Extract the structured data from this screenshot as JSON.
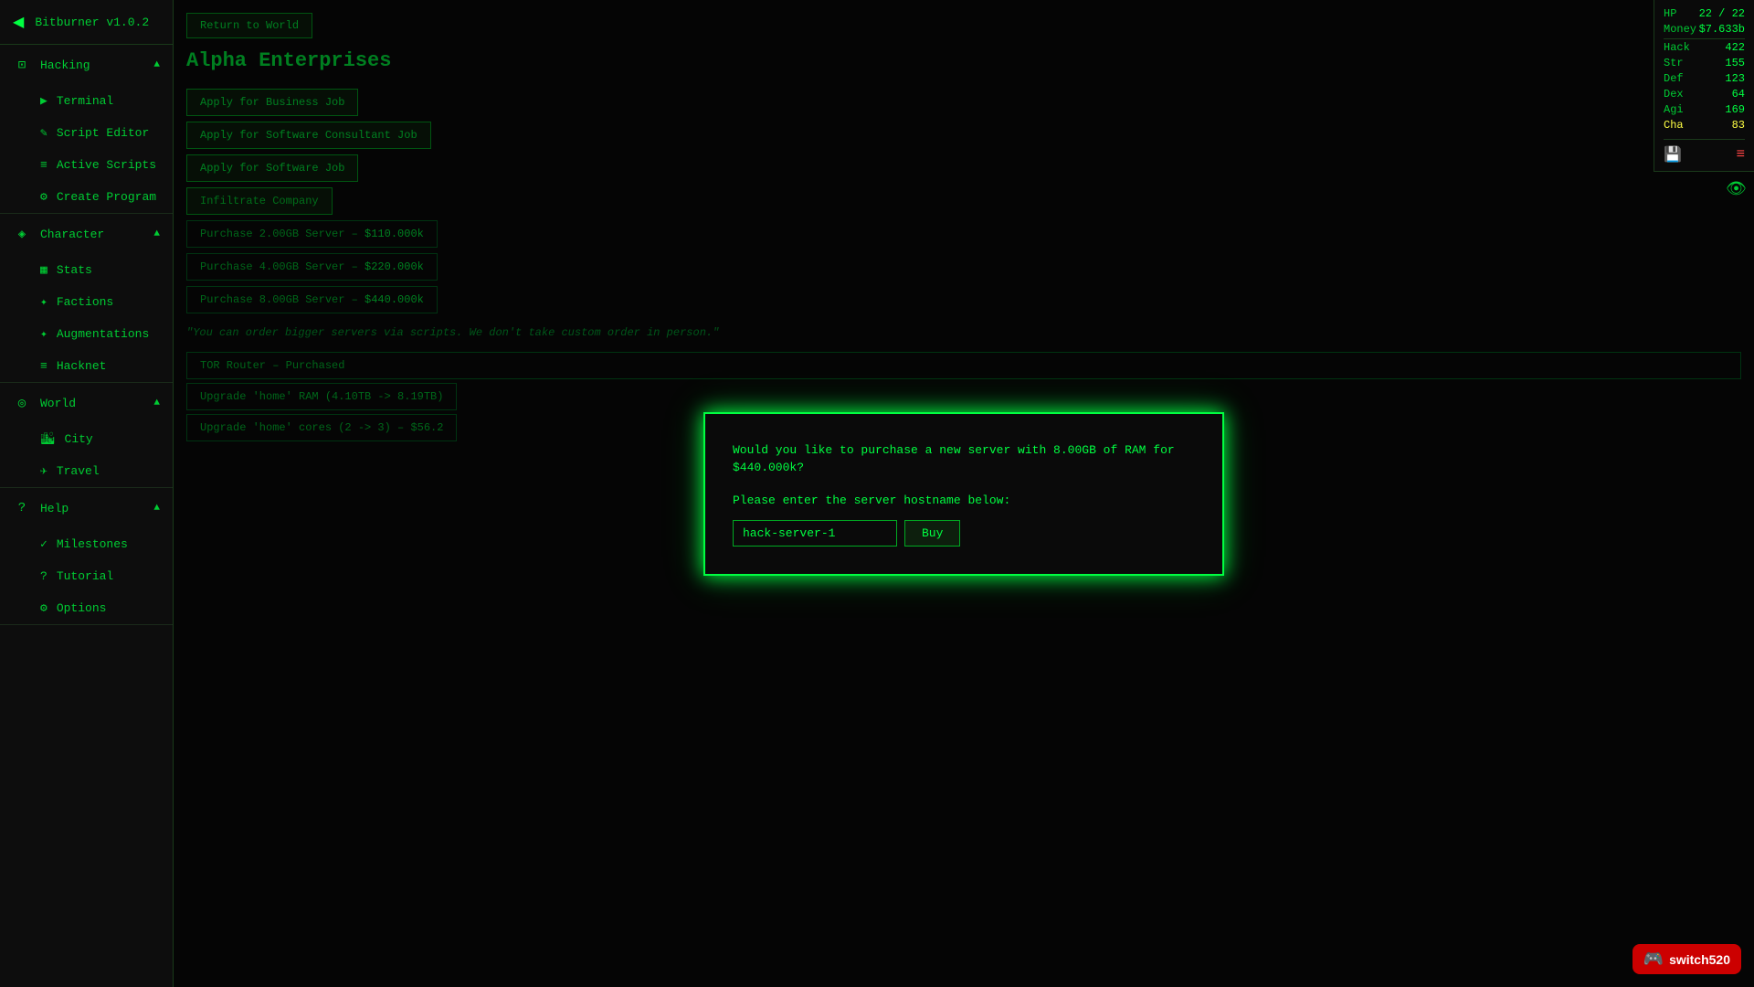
{
  "app": {
    "title": "Bitburner v1.0.2",
    "back_label": "◀"
  },
  "nav": {
    "return_to_world": "Return to World",
    "hacking": {
      "label": "Hacking",
      "icon": "⊞",
      "expanded": true,
      "children": [
        {
          "label": "Terminal",
          "icon": "▶"
        },
        {
          "label": "Script Editor",
          "icon": "✎"
        },
        {
          "label": "Active Scripts",
          "icon": "≡"
        },
        {
          "label": "Create Program",
          "icon": "⚙"
        }
      ]
    },
    "character": {
      "label": "Character",
      "icon": "👤",
      "expanded": true,
      "children": [
        {
          "label": "Stats",
          "icon": "📊"
        },
        {
          "label": "Factions",
          "icon": "✦"
        },
        {
          "label": "Augmentations",
          "icon": "✦"
        },
        {
          "label": "Hacknet",
          "icon": "≡"
        }
      ]
    },
    "world": {
      "label": "World",
      "icon": "🌐",
      "expanded": true,
      "children": [
        {
          "label": "City",
          "icon": "🏙"
        },
        {
          "label": "Travel",
          "icon": "✈"
        }
      ]
    },
    "help": {
      "label": "Help",
      "icon": "?",
      "expanded": true,
      "children": [
        {
          "label": "Milestones",
          "icon": "✓"
        },
        {
          "label": "Tutorial",
          "icon": "?"
        },
        {
          "label": "Options",
          "icon": "⚙"
        }
      ]
    }
  },
  "company": {
    "title": "Alpha Enterprises",
    "buttons": {
      "apply_business": "Apply for Business Job",
      "apply_software_consultant": "Apply for Software Consultant Job",
      "apply_software": "Apply for Software Job",
      "infiltrate": "Infiltrate Company",
      "purchase_2gb": "Purchase 2.00GB Server –",
      "purchase_2gb_price": "$110.000k",
      "purchase_4gb": "Purchase 4.00GB Server –",
      "purchase_4gb_price": "$220.000k",
      "purchase_8gb": "Purchase 8.00GB Server –",
      "purchase_8gb_price": "$440.000k"
    },
    "quote": "\"You can order bigger servers via scripts. We don't take custom order in person.\"",
    "tor_label": "TOR Router – Purchased",
    "upgrade_ram": "Upgrade 'home' RAM (4.10TB -> 8.19TB)",
    "upgrade_cores": "Upgrade 'home' cores (2 -> 3) – $56.2"
  },
  "modal": {
    "question": "Would you like to purchase a new server with 8.00GB of RAM for $440.000k?",
    "prompt": "Please enter the server hostname below:",
    "hostname_placeholder": "hack-server-1",
    "hostname_value": "hack-server-1",
    "buy_label": "Buy"
  },
  "stats": {
    "hp_label": "HP",
    "hp_current": "22",
    "hp_max": "22",
    "money_label": "Money",
    "money_value": "$7.633b",
    "hack_label": "Hack",
    "hack_value": "422",
    "str_label": "Str",
    "str_value": "155",
    "def_label": "Def",
    "def_value": "123",
    "dex_label": "Dex",
    "dex_value": "64",
    "agi_label": "Agi",
    "agi_value": "169",
    "cha_label": "Cha",
    "cha_value": "83"
  },
  "nintendo": {
    "brand": "switch520"
  }
}
